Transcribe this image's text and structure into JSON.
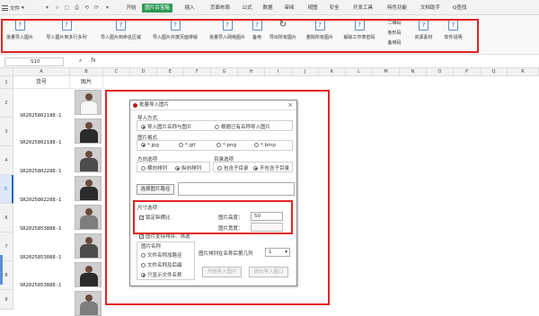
{
  "menubar": {
    "file_label": "文件",
    "quick_icons": [
      "▾",
      "⌕",
      "▢",
      "⎙",
      "⟲",
      "⟳",
      "▾"
    ],
    "items": [
      "开始",
      "图片百宝箱",
      "插入",
      "页面布局",
      "公式",
      "数据",
      "审阅",
      "视图",
      "安全",
      "开发工具",
      "特色功能",
      "文档助手"
    ],
    "search_label": "Q查找"
  },
  "ribbon": {
    "buttons": [
      "批量导入图片",
      "导入图片到多行多列",
      "导入图片到命名区域",
      "导入图片并按页面排版",
      "批量导入网络图片",
      "备用",
      "导出所有图片",
      "删除所有图片",
      "解除工作表密码"
    ],
    "small_buttons": [
      "二维码",
      "条形码",
      "备用码"
    ],
    "right_buttons": [
      "资源素材",
      "软件说明"
    ],
    "icon_glyph": "?",
    "refresh_glyph": "↻"
  },
  "formula": {
    "cell_ref": "S10",
    "fx": "fx"
  },
  "sheet": {
    "columns": [
      "A",
      "B",
      "C",
      "D",
      "E",
      "F",
      "G",
      "H",
      "I",
      "J",
      "K",
      "L",
      "M",
      "N",
      "O",
      "P",
      "Q",
      "R"
    ],
    "header_row": {
      "a": "货号",
      "b": "图片"
    },
    "rows": [
      {
        "num": "1",
        "code": ""
      },
      {
        "num": "2",
        "code": "SR2025802188-1"
      },
      {
        "num": "3",
        "code": "SR2025802188-1"
      },
      {
        "num": "4",
        "code": "SR2025802288-1"
      },
      {
        "num": "5",
        "code": "SR2025802288-1"
      },
      {
        "num": "6",
        "code": "SR2025853888-1"
      },
      {
        "num": "7",
        "code": "SR2025853888-1"
      },
      {
        "num": "8",
        "code": "SR2025853888-1"
      },
      {
        "num": "9",
        "code": "SR2025853888-1"
      },
      {
        "num": "10",
        "code": ""
      }
    ]
  },
  "dialog": {
    "title": "批量导入图片",
    "close": "×",
    "import_mode_label": "导入方式",
    "mode_options": [
      "导入图片名称与图片",
      "根据已有名称导入图片"
    ],
    "format_label": "图片格式",
    "formats": [
      "*.jpg",
      "*.gif",
      "*.png",
      "*.bmp"
    ],
    "direction_label": "方向选项",
    "directions": [
      "横向排列",
      "纵向排列"
    ],
    "subfolder_label": "目录选项",
    "subfolder_options": [
      "包含子目录",
      "不包含子目录"
    ],
    "path_button": "选择图片路径",
    "size_label": "尺寸选项",
    "lock_ratio": "锁定纵横比",
    "height_label": "图片高度：",
    "height_value": "50",
    "width_label": "图片宽度：",
    "sort_filter": "图片支持排序、筛选",
    "name_label": "图片名称",
    "name_options": [
      "文件名称加路径",
      "文件名称及后缀",
      "只显示文件名称"
    ],
    "position_label": "图片排列在名称后第几列",
    "position_value": "1",
    "start_button": "开始导入图片",
    "cancel_button": "退出导入窗口"
  }
}
